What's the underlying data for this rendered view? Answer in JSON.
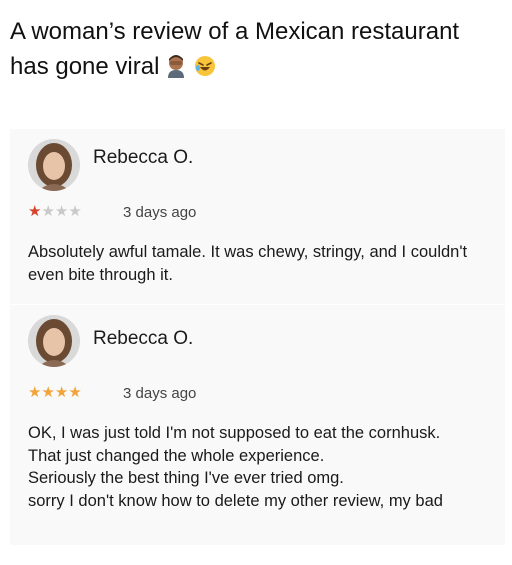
{
  "headline": {
    "text": "A woman’s review of a Mexican restaurant has gone viral",
    "emojis": [
      "facepalm-emoji",
      "rolling-on-floor-laughing-emoji"
    ]
  },
  "reviews": [
    {
      "name": "Rebecca O.",
      "rating": 1,
      "max_rating": 4,
      "date": "3 days ago",
      "text": "Absolutely awful tamale. It was chewy, stringy, and I couldn't even bite through it."
    },
    {
      "name": "Rebecca O.",
      "rating": 4,
      "max_rating": 4,
      "date": "3 days ago",
      "lines": [
        "OK, I was just told I'm not supposed to eat the cornhusk.",
        "That just changed the whole experience.",
        "Seriously the best thing I've ever tried omg.",
        "sorry I don't know how to delete my other review, my bad"
      ]
    }
  ],
  "colors": {
    "star_filled_low": "#d9412b",
    "star_filled_high": "#f2a43a",
    "star_empty": "#c9c9c9",
    "card_background": "#f9f9f9"
  }
}
